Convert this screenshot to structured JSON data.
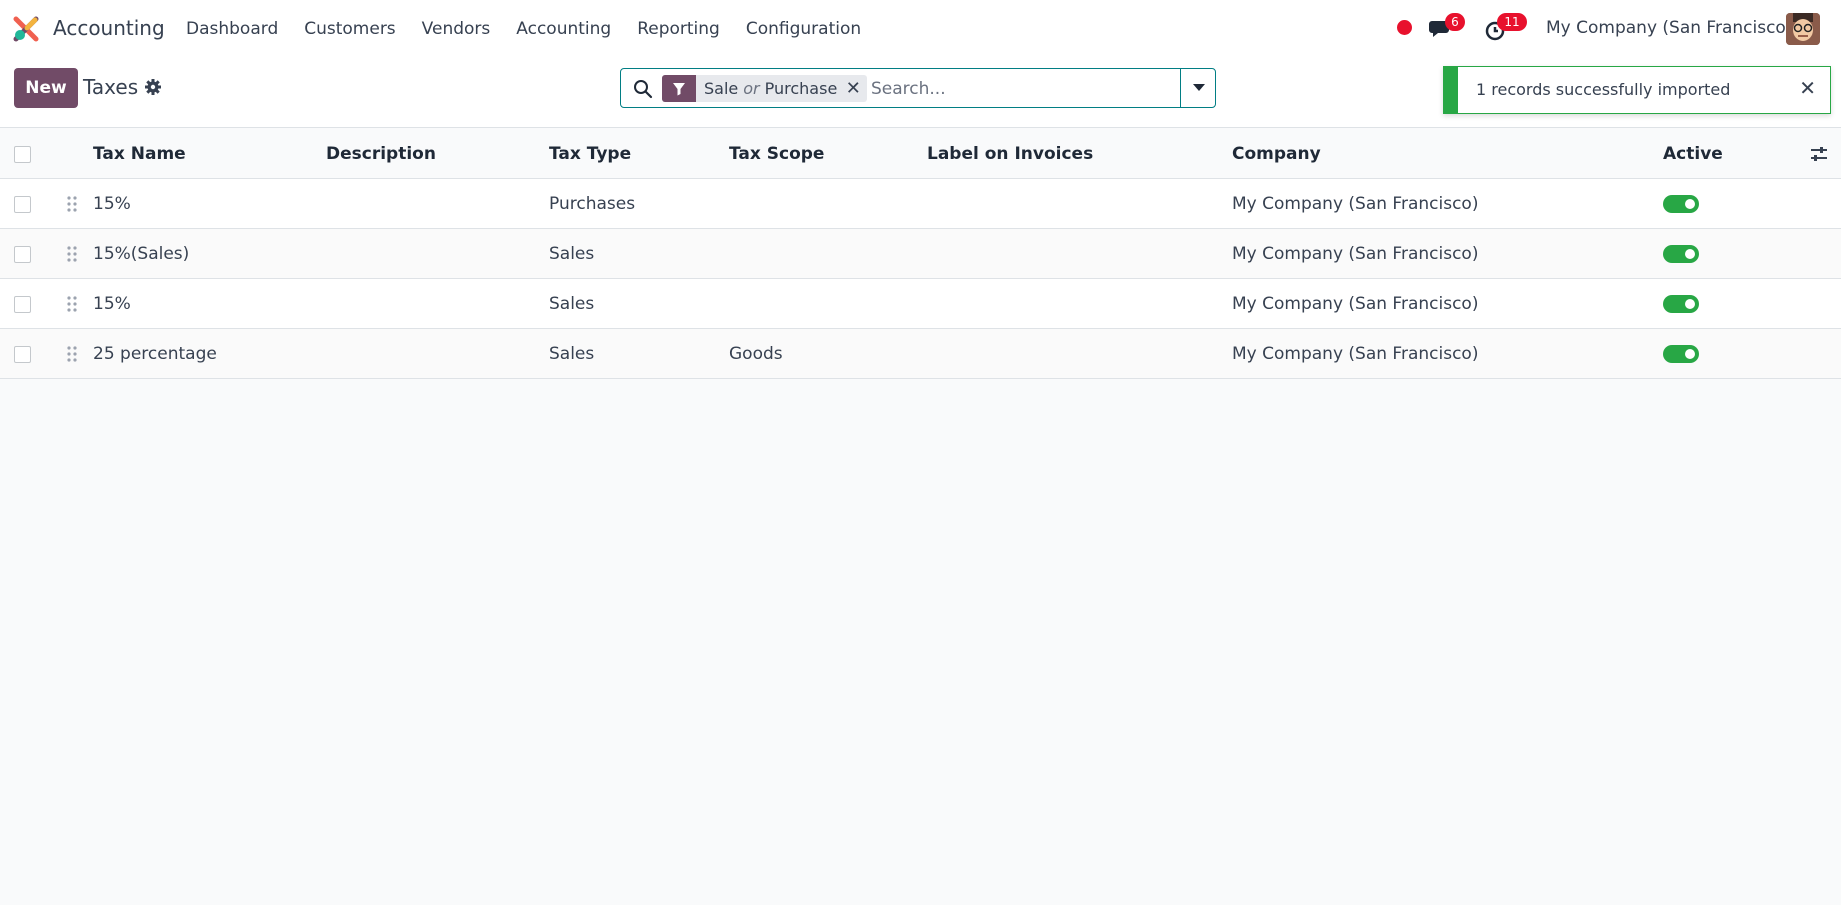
{
  "app": {
    "name": "Accounting"
  },
  "menu": [
    "Dashboard",
    "Customers",
    "Vendors",
    "Accounting",
    "Reporting",
    "Configuration"
  ],
  "systray": {
    "chat_count": "6",
    "activity_count": "11",
    "company": "My Company (San Francisco)"
  },
  "control": {
    "new_label": "New",
    "title": "Taxes",
    "facet": {
      "value1": "Sale",
      "separator": "or",
      "value2": "Purchase",
      "remove": "✕"
    },
    "search_placeholder": "Search..."
  },
  "toast": {
    "message": "1 records successfully imported",
    "close": "✕"
  },
  "table": {
    "columns": [
      "Tax Name",
      "Description",
      "Tax Type",
      "Tax Scope",
      "Label on Invoices",
      "Company",
      "Active"
    ],
    "rows": [
      {
        "name": "15%",
        "description": "",
        "type": "Purchases",
        "scope": "",
        "label": "",
        "company": "My Company (San Francisco)",
        "active": true
      },
      {
        "name": "15%(Sales)",
        "description": "",
        "type": "Sales",
        "scope": "",
        "label": "",
        "company": "My Company (San Francisco)",
        "active": true
      },
      {
        "name": "15%",
        "description": "",
        "type": "Sales",
        "scope": "",
        "label": "",
        "company": "My Company (San Francisco)",
        "active": true
      },
      {
        "name": "25 percentage",
        "description": "",
        "type": "Sales",
        "scope": "Goods",
        "label": "",
        "company": "My Company (San Francisco)",
        "active": true
      }
    ]
  },
  "colors": {
    "brand": "#714b67",
    "accent": "#017e84",
    "success": "#28a745",
    "badge": "#e8112d"
  }
}
